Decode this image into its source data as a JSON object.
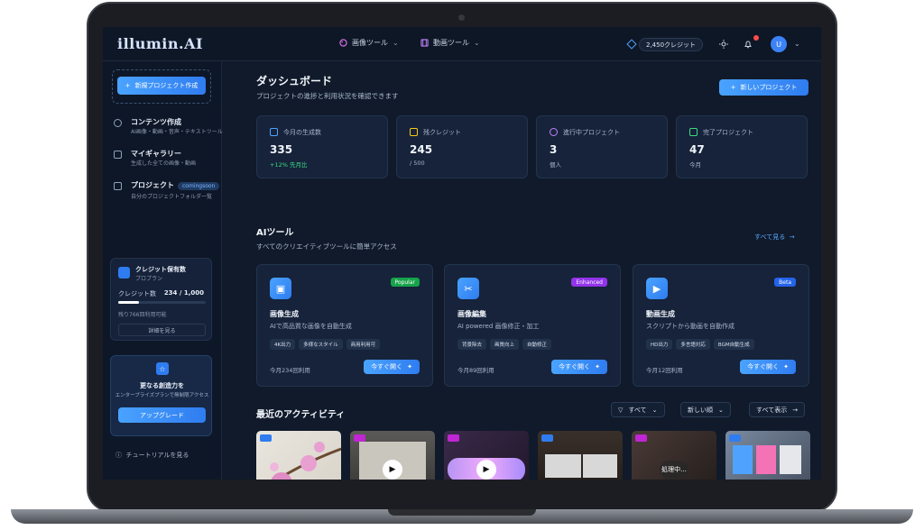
{
  "app": {
    "logo": "illumin.AI"
  },
  "nav": {
    "image_tools": "画像ツール",
    "video_tools": "動画ツール",
    "credits": "2,450クレジット",
    "avatar_initial": "U"
  },
  "sidebar": {
    "new_project": "新規プロジェクト作成",
    "items": [
      {
        "title": "コンテンツ作成",
        "sub": "AI画像・動画・音声・テキストツール"
      },
      {
        "title": "マイギャラリー",
        "sub": "生成した全ての画像・動画"
      },
      {
        "title": "プロジェクト",
        "badge": "comingsoon",
        "sub": "自分のプロジェクトフォルダ一覧"
      }
    ],
    "credit_card": {
      "title": "クレジット保有数",
      "plan": "プロプラン",
      "label": "クレジット数",
      "value": "234 / 1,000",
      "progress": 0.234,
      "remaining": "残り766回利用可能",
      "details": "詳細を見る"
    },
    "upgrade_card": {
      "title": "更なる創造力を",
      "sub": "エンタープライズプランで無制限アクセス",
      "button": "アップグレード"
    },
    "tutorial": "チュートリアルを見る"
  },
  "main": {
    "title": "ダッシュボード",
    "subtitle": "プロジェクトの進捗と利用状況を確認できます",
    "new_button": "新しいプロジェクト",
    "stats": [
      {
        "label": "今月の生成数",
        "value": "335",
        "sub": "+12% 先月比",
        "sub_color": "#3ddc84"
      },
      {
        "label": "残クレジット",
        "value": "245",
        "sub": "/ 500",
        "sub_color": "#a8b6cb"
      },
      {
        "label": "進行中プロジェクト",
        "value": "3",
        "sub": "個人",
        "sub_color": "#a8b6cb"
      },
      {
        "label": "完了プロジェクト",
        "value": "47",
        "sub": "今月",
        "sub_color": "#a8b6cb"
      }
    ],
    "ai_tools": {
      "title": "AIツール",
      "subtitle": "すべてのクリエイティブツールに簡単アクセス",
      "see_all": "すべて見る",
      "cards": [
        {
          "title": "画像生成",
          "desc": "AIで高品質な画像を自動生成",
          "tag": "Popular",
          "tag_color": "#16a34a",
          "chips": [
            "4K出力",
            "多様なスタイル",
            "商用利用可"
          ],
          "usage": "今月234回利用",
          "button": "今すぐ開く"
        },
        {
          "title": "画像編集",
          "desc": "AI powered 画像修正・加工",
          "tag": "Enhanced",
          "tag_color": "#9333ea",
          "chips": [
            "背景除去",
            "画質向上",
            "自動修正"
          ],
          "usage": "今月89回利用",
          "button": "今すぐ開く"
        },
        {
          "title": "動画生成",
          "desc": "スクリプトから動画を自動作成",
          "tag": "Beta",
          "tag_color": "#2563eb",
          "chips": [
            "HD出力",
            "多言語対応",
            "BGM自動生成"
          ],
          "usage": "今月12回利用",
          "button": "今すぐ開く"
        }
      ]
    },
    "activity": {
      "title": "最近のアクティビティ",
      "filter_all": "すべて",
      "sort": "新しい順",
      "show_all": "すべて表示",
      "processing": "処理中..."
    }
  },
  "colors": {
    "accent": "#2f7cf0",
    "bg": "#101a2a",
    "card": "#16233a"
  }
}
